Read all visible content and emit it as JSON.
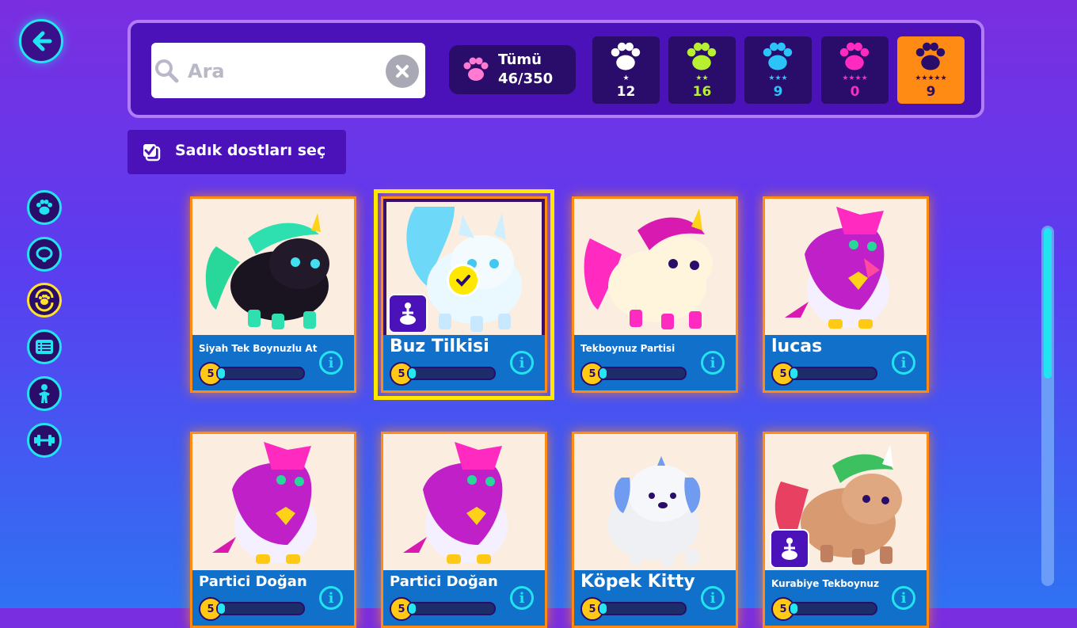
{
  "search": {
    "placeholder": "Ara"
  },
  "all_filter": {
    "label": "Tümü",
    "count": "46/350"
  },
  "rarity_filters": [
    {
      "stars": "★",
      "count": "12",
      "color": "#ffffff"
    },
    {
      "stars": "★★",
      "count": "16",
      "color": "#b6f030"
    },
    {
      "stars": "★★★",
      "count": "9",
      "color": "#2cc4f8"
    },
    {
      "stars": "★★★★",
      "count": "0",
      "color": "#ff2ac0"
    },
    {
      "stars": "★★★★★",
      "count": "9",
      "color": "#2a0c6a"
    }
  ],
  "loyal_button": {
    "label": "Sadık dostları seç"
  },
  "pets": [
    {
      "name": "Siyah Tek Boynuzlu At",
      "level": "5",
      "xp": 0.05
    },
    {
      "name": "Buz Tilkisi",
      "level": "5",
      "xp": 0.05
    },
    {
      "name": "Tekboynuz Partisi",
      "level": "5",
      "xp": 0.05
    },
    {
      "name": "lucas",
      "level": "5",
      "xp": 0.05
    },
    {
      "name": "Partici Doğan",
      "level": "5",
      "xp": 0.05
    },
    {
      "name": "Partici Doğan",
      "level": "5",
      "xp": 0.05
    },
    {
      "name": "Köpek Kitty",
      "level": "5",
      "xp": 0.05
    },
    {
      "name": "Kurabiye Tekboynuz",
      "level": "5",
      "xp": 0.05
    }
  ],
  "colors": {
    "accent": "#22e4f0",
    "card_border": "#ff8a14",
    "selected": "#ffe800"
  }
}
